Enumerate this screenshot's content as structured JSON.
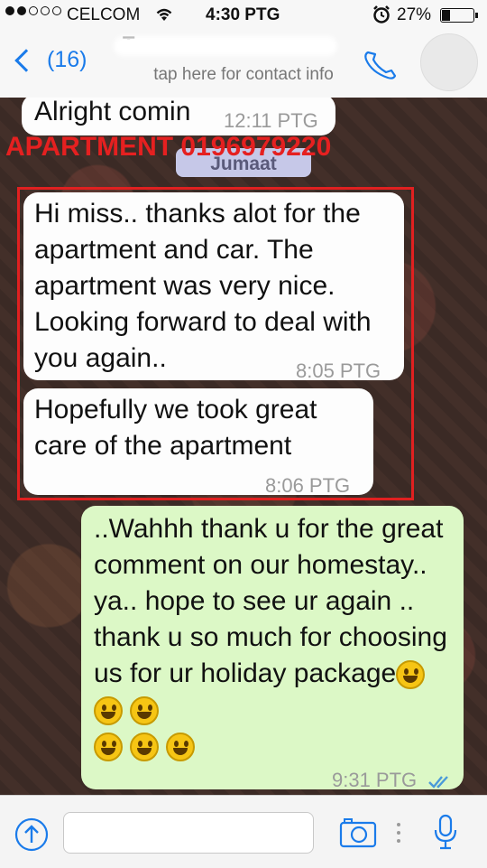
{
  "status_bar": {
    "carrier": "CELCOM",
    "time": "4:30 PTG",
    "battery_text": "27%",
    "battery_level_percent": 27,
    "signal_bars_filled": 2,
    "signal_bars_total": 5
  },
  "nav": {
    "back_label": "(16)",
    "contact_name_visible": "T",
    "subtitle": "tap here for contact info",
    "icons": [
      "chevron-left-icon",
      "phone-icon",
      "avatar"
    ],
    "accent_color": "#1a7bea"
  },
  "chat": {
    "watermark": "APARTMENT 0196979220",
    "day_header": "Jumaat",
    "messages": [
      {
        "direction": "incoming",
        "text": "Alright comin",
        "time": "12:11 PTG"
      },
      {
        "direction": "incoming",
        "text": "Hi miss.. thanks alot for the apartment and car. The apartment was very nice. Looking forward to deal with you again..",
        "time": "8:05 PTG"
      },
      {
        "direction": "incoming",
        "text": "Hopefully we took great care of the apartment",
        "time": "8:06 PTG"
      },
      {
        "direction": "outgoing",
        "text": "..Wahhh thank u for the great comment on our homestay.. ya.. hope to see ur again .. thank u so much for choosing us for ur holiday package",
        "emoji_count": 6,
        "emoji": "grinning-face",
        "time": "9:31 PTG",
        "read_ticks": "double-check-blue"
      }
    ],
    "highlight_color": "#e02020",
    "incoming_color": "#fdfdfd",
    "outgoing_color": "#dcf8c6"
  },
  "input_bar": {
    "icons": [
      "share-up-icon",
      "camera-icon",
      "microphone-icon"
    ],
    "text_value": ""
  }
}
